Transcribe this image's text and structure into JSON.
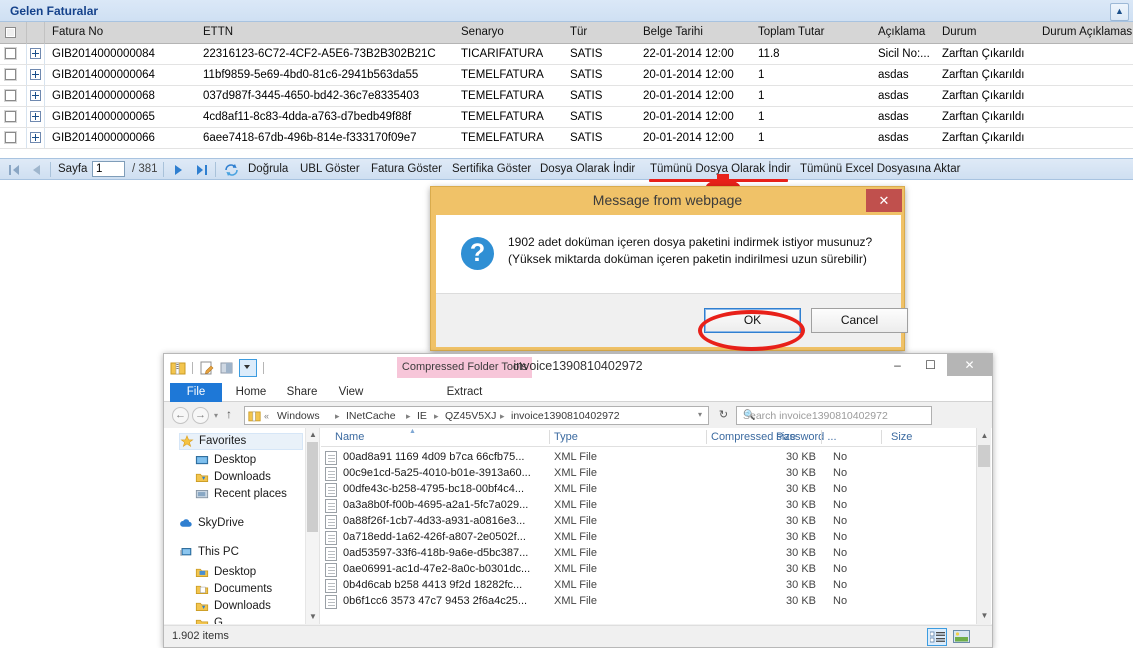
{
  "webapp": {
    "panel_title": "Gelen Faturalar",
    "collapse_icon": "collapse-up-icon",
    "grid": {
      "columns": [
        "Fatura No",
        "ETTN",
        "Senaryo",
        "Tür",
        "Belge Tarihi",
        "Toplam Tutar",
        "Açıklama",
        "Durum",
        "Durum Açıklaması"
      ],
      "rows": [
        {
          "fatura_no": "GIB2014000000084",
          "ettn": "22316123-6C72-4CF2-A5E6-73B2B302B21C",
          "senaryo": "TICARIFATURA",
          "tur": "SATIS",
          "belge_tarihi": "22-01-2014 12:00",
          "toplam_tutar": "11.8",
          "aciklama": "Sicil No:...",
          "durum": "Zarftan Çıkarıldı",
          "durum_aciklamasi": ""
        },
        {
          "fatura_no": "GIB2014000000064",
          "ettn": "11bf9859-5e69-4bd0-81c6-2941b563da55",
          "senaryo": "TEMELFATURA",
          "tur": "SATIS",
          "belge_tarihi": "20-01-2014 12:00",
          "toplam_tutar": "1",
          "aciklama": "asdas",
          "durum": "Zarftan Çıkarıldı",
          "durum_aciklamasi": ""
        },
        {
          "fatura_no": "GIB2014000000068",
          "ettn": "037d987f-3445-4650-bd42-36c7e8335403",
          "senaryo": "TEMELFATURA",
          "tur": "SATIS",
          "belge_tarihi": "20-01-2014 12:00",
          "toplam_tutar": "1",
          "aciklama": "asdas",
          "durum": "Zarftan Çıkarıldı",
          "durum_aciklamasi": ""
        },
        {
          "fatura_no": "GIB2014000000065",
          "ettn": "4cd8af11-8c83-4dda-a763-d7bedb49f88f",
          "senaryo": "TEMELFATURA",
          "tur": "SATIS",
          "belge_tarihi": "20-01-2014 12:00",
          "toplam_tutar": "1",
          "aciklama": "asdas",
          "durum": "Zarftan Çıkarıldı",
          "durum_aciklamasi": ""
        },
        {
          "fatura_no": "GIB2014000000066",
          "ettn": "6aee7418-67db-496b-814e-f333170f09e7",
          "senaryo": "TEMELFATURA",
          "tur": "SATIS",
          "belge_tarihi": "20-01-2014 12:00",
          "toplam_tutar": "1",
          "aciklama": "asdas",
          "durum": "Zarftan Çıkarıldı",
          "durum_aciklamasi": ""
        }
      ]
    },
    "toolbar": {
      "page_label": "Sayfa",
      "page_value": "1",
      "page_total": "/ 381",
      "first_icon": "first-page-icon",
      "prev_icon": "previous-page-icon",
      "next_icon": "next-page-icon",
      "last_icon": "last-page-icon",
      "refresh_icon": "refresh-icon",
      "actions": [
        "Doğrula",
        "UBL Göster",
        "Fatura Göster",
        "Sertifika Göster",
        "Dosya Olarak İndir",
        "Tümünü Dosya Olarak İndir",
        "Tümünü Excel Dosyasına Aktar"
      ]
    }
  },
  "dialog": {
    "title": "Message from webpage",
    "close_icon": "close-icon",
    "question_icon": "question-icon",
    "message_line1": "1902 adet doküman içeren dosya paketini indirmek istiyor musunuz?",
    "message_line2": "(Yüksek miktarda doküman içeren paketin indirilmesi uzun sürebilir)",
    "ok_label": "OK",
    "cancel_label": "Cancel"
  },
  "explorer": {
    "window_title": "invoice1390810402972",
    "contextual_tab": "Compressed Folder Tools",
    "quick_access_icons": [
      "zip-folder-icon",
      "properties-icon",
      "new-folder-icon",
      "customize-dropdown-icon"
    ],
    "minimize_icon": "minimize-icon",
    "maximize_icon": "maximize-icon",
    "close_icon": "close-icon",
    "ribbon_tabs": [
      "File",
      "Home",
      "Share",
      "View",
      "Extract"
    ],
    "help_icon": "help-icon",
    "ribbon_collapse_icon": "chevron-down-icon",
    "back_icon": "back-arrow-icon",
    "forward_icon": "forward-arrow-icon",
    "recent_icon": "recent-dropdown-icon",
    "up_icon": "up-arrow-icon",
    "refresh_icon": "refresh-icon",
    "address_dropdown_icon": "chevron-down-icon",
    "breadcrumbs": [
      "Windows",
      "INetCache",
      "IE",
      "QZ45V5XJ",
      "invoice1390810402972"
    ],
    "search_placeholder": "Search invoice1390810402972",
    "search_icon": "search-icon",
    "nav_pane": [
      {
        "label": "Favorites",
        "icon": "star-icon",
        "indent": 14,
        "selected": true
      },
      {
        "label": "Desktop",
        "icon": "desktop-icon",
        "indent": 30,
        "selected": false
      },
      {
        "label": "Downloads",
        "icon": "downloads-folder-icon",
        "indent": 30,
        "selected": false
      },
      {
        "label": "Recent places",
        "icon": "recent-places-icon",
        "indent": 30,
        "selected": false
      },
      {
        "label": "SkyDrive",
        "icon": "skydrive-icon",
        "indent": 14,
        "selected": false
      },
      {
        "label": "This PC",
        "icon": "this-pc-icon",
        "indent": 14,
        "selected": false
      },
      {
        "label": "Desktop",
        "icon": "desktop-folder-icon",
        "indent": 30,
        "selected": false
      },
      {
        "label": "Documents",
        "icon": "documents-folder-icon",
        "indent": 30,
        "selected": false
      },
      {
        "label": "Downloads",
        "icon": "downloads-folder-icon",
        "indent": 30,
        "selected": false
      },
      {
        "label": "G",
        "icon": "network-drive-icon",
        "indent": 30,
        "selected": false
      }
    ],
    "file_columns": [
      "Name",
      "Type",
      "Compressed size",
      "Password ...",
      "Size"
    ],
    "sort_indicator_icon": "sort-ascending-icon",
    "files": [
      {
        "name": "00ad8a91 1169 4d09 b7ca 66cfb75...",
        "type": "XML File",
        "compressed_size": "30 KB",
        "password": "No",
        "size": ""
      },
      {
        "name": "00c9e1cd-5a25-4010-b01e-3913a60...",
        "type": "XML File",
        "compressed_size": "30 KB",
        "password": "No",
        "size": ""
      },
      {
        "name": "00dfe43c-b258-4795-bc18-00bf4c4...",
        "type": "XML File",
        "compressed_size": "30 KB",
        "password": "No",
        "size": ""
      },
      {
        "name": "0a3a8b0f-f00b-4695-a2a1-5fc7a029...",
        "type": "XML File",
        "compressed_size": "30 KB",
        "password": "No",
        "size": ""
      },
      {
        "name": "0a88f26f-1cb7-4d33-a931-a0816e3...",
        "type": "XML File",
        "compressed_size": "30 KB",
        "password": "No",
        "size": ""
      },
      {
        "name": "0a718edd-1a62-426f-a807-2e0502f...",
        "type": "XML File",
        "compressed_size": "30 KB",
        "password": "No",
        "size": ""
      },
      {
        "name": "0ad53597-33f6-418b-9a6e-d5bc387...",
        "type": "XML File",
        "compressed_size": "30 KB",
        "password": "No",
        "size": ""
      },
      {
        "name": "0ae06991-ac1d-47e2-8a0c-b0301dc...",
        "type": "XML File",
        "compressed_size": "30 KB",
        "password": "No",
        "size": ""
      },
      {
        "name": "0b4d6cab b258 4413 9f2d 18282fc...",
        "type": "XML File",
        "compressed_size": "30 KB",
        "password": "No",
        "size": ""
      },
      {
        "name": "0b6f1cc6 3573 47c7 9453 2f6a4c25...",
        "type": "XML File",
        "compressed_size": "30 KB",
        "password": "No",
        "size": ""
      }
    ],
    "status_count": "1.902 items",
    "details_view_icon": "details-view-icon",
    "large-icons_view_icon": "large-icons-view-icon"
  },
  "annotations": {
    "underline_color": "#e8211a",
    "ellipse_color": "#e8211a",
    "arrow_color": "#e8211a"
  }
}
